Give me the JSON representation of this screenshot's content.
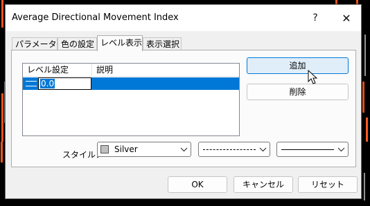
{
  "window": {
    "title": "Average Directional Movement Index",
    "help_glyph": "?",
    "close_glyph": "✕"
  },
  "tabs": [
    {
      "label": "パラメーター",
      "active": false
    },
    {
      "label": "色の設定",
      "active": false
    },
    {
      "label": "レベル表示",
      "active": true
    },
    {
      "label": "表示選択",
      "active": false
    }
  ],
  "levels": {
    "columns": [
      "レベル設定",
      "説明"
    ],
    "rows": [
      {
        "value": "0.0",
        "description": ""
      }
    ]
  },
  "buttons": {
    "add": "追加",
    "delete": "削除",
    "ok": "OK",
    "cancel": "キャンセル",
    "reset": "リセット"
  },
  "style": {
    "label": "スタイル：",
    "color_name": "Silver",
    "color_hex": "#c0c0c0",
    "line_style": "dashed",
    "line_width": "thin-solid"
  },
  "colors": {
    "selection": "#0078d7",
    "chart_red": "#ff5a1f",
    "chart_gray": "#9a9a9a"
  }
}
